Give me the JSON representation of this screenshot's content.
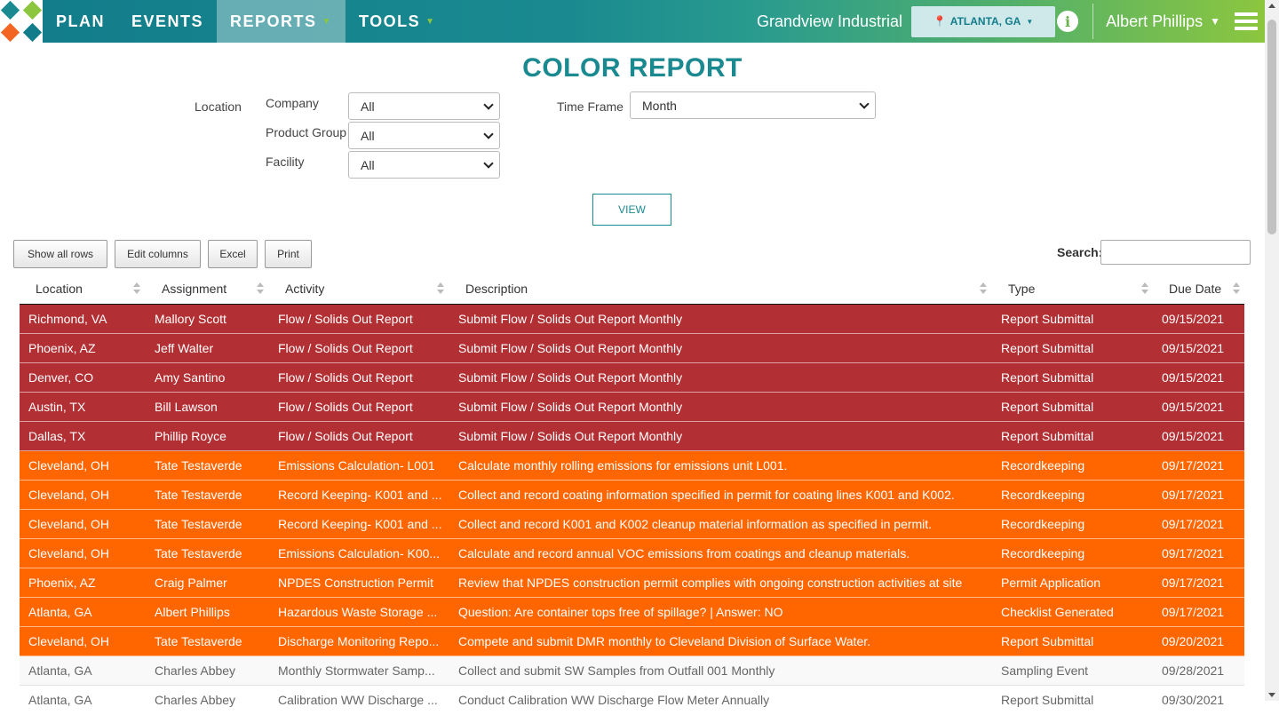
{
  "nav": {
    "items": [
      {
        "label": "PLAN",
        "active": false,
        "caret": false
      },
      {
        "label": "EVENTS",
        "active": false,
        "caret": false
      },
      {
        "label": "REPORTS",
        "active": true,
        "caret": true
      },
      {
        "label": "TOOLS",
        "active": false,
        "caret": true
      }
    ],
    "company": "Grandview Industrial",
    "location_button": "ATLANTA, GA",
    "user": "Albert Phillips"
  },
  "page_title": "COLOR REPORT",
  "filters": {
    "location_label": "Location",
    "company_label": "Company",
    "company_value": "All",
    "product_group_label": "Product Group",
    "product_group_value": "All",
    "facility_label": "Facility",
    "facility_value": "All",
    "time_frame_label": "Time Frame",
    "time_frame_value": "Month",
    "view_button": "VIEW"
  },
  "toolbar": {
    "show_all_rows": "Show all rows",
    "edit_columns": "Edit columns",
    "excel": "Excel",
    "print": "Print",
    "search_label": "Search:"
  },
  "table": {
    "headers": [
      "Location",
      "Assignment",
      "Activity",
      "Description",
      "Type",
      "Due Date"
    ],
    "rows": [
      {
        "status": "red",
        "location": "Richmond, VA",
        "assignment": "Mallory Scott",
        "activity": "Flow / Solids Out Report",
        "description": "Submit Flow / Solids Out Report Monthly",
        "type": "Report Submittal",
        "due": "09/15/2021"
      },
      {
        "status": "red",
        "location": "Phoenix, AZ",
        "assignment": "Jeff Walter",
        "activity": "Flow / Solids Out Report",
        "description": "Submit Flow / Solids Out Report Monthly",
        "type": "Report Submittal",
        "due": "09/15/2021"
      },
      {
        "status": "red",
        "location": "Denver, CO",
        "assignment": "Amy Santino",
        "activity": "Flow / Solids Out Report",
        "description": "Submit Flow / Solids Out Report Monthly",
        "type": "Report Submittal",
        "due": "09/15/2021"
      },
      {
        "status": "red",
        "location": "Austin, TX",
        "assignment": "Bill Lawson",
        "activity": "Flow / Solids Out Report",
        "description": "Submit Flow / Solids Out Report Monthly",
        "type": "Report Submittal",
        "due": "09/15/2021"
      },
      {
        "status": "red",
        "location": "Dallas, TX",
        "assignment": "Phillip Royce",
        "activity": "Flow / Solids Out Report",
        "description": "Submit Flow / Solids Out Report Monthly",
        "type": "Report Submittal",
        "due": "09/15/2021"
      },
      {
        "status": "orange",
        "location": "Cleveland, OH",
        "assignment": "Tate Testaverde",
        "activity": "Emissions Calculation- L001",
        "description": "Calculate monthly rolling emissions for emissions unit L001.",
        "type": "Recordkeeping",
        "due": "09/17/2021"
      },
      {
        "status": "orange",
        "location": "Cleveland, OH",
        "assignment": "Tate Testaverde",
        "activity": "Record Keeping- K001 and ...",
        "description": "Collect and record coating information specified in permit for coating lines K001 and K002.",
        "type": "Recordkeeping",
        "due": "09/17/2021"
      },
      {
        "status": "orange",
        "location": "Cleveland, OH",
        "assignment": "Tate Testaverde",
        "activity": "Record Keeping- K001 and ...",
        "description": "Collect and record K001 and K002 cleanup material information as specified in permit.",
        "type": "Recordkeeping",
        "due": "09/17/2021"
      },
      {
        "status": "orange",
        "location": "Cleveland, OH",
        "assignment": "Tate Testaverde",
        "activity": "Emissions Calculation- K00...",
        "description": "Calculate and record annual VOC emissions from coatings and cleanup materials.",
        "type": "Recordkeeping",
        "due": "09/17/2021"
      },
      {
        "status": "orange",
        "location": "Phoenix, AZ",
        "assignment": "Craig Palmer",
        "activity": "NPDES Construction Permit",
        "description": "Review that NPDES construction permit complies with ongoing construction activities at site",
        "type": "Permit Application",
        "due": "09/17/2021"
      },
      {
        "status": "orange",
        "location": "Atlanta, GA",
        "assignment": "Albert Phillips",
        "activity": "Hazardous Waste Storage ...",
        "description": "Question: Are container tops free of spillage? | Answer: NO",
        "type": "Checklist Generated",
        "due": "09/17/2021"
      },
      {
        "status": "orange",
        "location": "Cleveland, OH",
        "assignment": "Tate Testaverde",
        "activity": "Discharge Monitoring Repo...",
        "description": "Compete and submit DMR monthly to Cleveland Division of Surface Water.",
        "type": "Report Submittal",
        "due": "09/20/2021"
      },
      {
        "status": "gray",
        "location": "Atlanta, GA",
        "assignment": "Charles Abbey",
        "activity": "Monthly Stormwater Samp...",
        "description": "Collect and submit SW Samples from Outfall 001 Monthly",
        "type": "Sampling Event",
        "due": "09/28/2021"
      },
      {
        "status": "white",
        "location": "Atlanta, GA",
        "assignment": "Charles Abbey",
        "activity": "Calibration WW Discharge ...",
        "description": "Conduct Calibration WW Discharge Flow Meter Annually",
        "type": "Report Submittal",
        "due": "09/30/2021"
      }
    ]
  },
  "colors": {
    "overdue": "#b22f33",
    "due_soon": "#ff6600",
    "accent": "#1a8a90"
  }
}
